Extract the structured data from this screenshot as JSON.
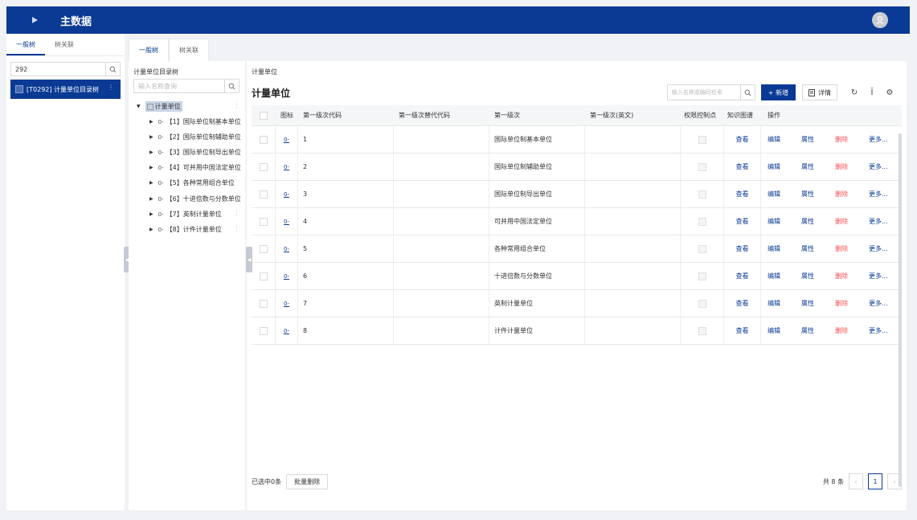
{
  "app": {
    "title": "主数据"
  },
  "left_panel": {
    "tabs": [
      "一般树",
      "树关联"
    ],
    "search_value": "292",
    "selected_item": "[T0292] 计量单位目录树"
  },
  "main_tabs": [
    "一般树",
    "树关联"
  ],
  "tree": {
    "label": "计量单位目录树",
    "search_placeholder": "输入名称查询",
    "root": "计量单位",
    "nodes": [
      "【1】国际单位制基本单位",
      "【2】国际单位制辅助单位",
      "【3】国际单位制导出单位",
      "【4】可并用中国法定单位",
      "【5】各种常用组合单位",
      "【6】十进倍数与分数单位",
      "【7】英制计量单位",
      "【8】计件计量单位"
    ]
  },
  "content": {
    "breadcrumb": "计量单位",
    "title": "计量单位",
    "search_placeholder": "输入名称或编码检索",
    "add_label": "+ 新增",
    "detail_label": "详情"
  },
  "grid": {
    "headers": [
      "图标",
      "第一级次代码",
      "第一级次替代代码",
      "第一级次",
      "第一级次(英文)",
      "权限控制点",
      "知识图谱",
      "操作"
    ],
    "rows": [
      {
        "code": "1",
        "alt": "",
        "name": "国际单位制基本单位",
        "en": ""
      },
      {
        "code": "2",
        "alt": "",
        "name": "国际单位制辅助单位",
        "en": ""
      },
      {
        "code": "3",
        "alt": "",
        "name": "国际单位制导出单位",
        "en": ""
      },
      {
        "code": "4",
        "alt": "",
        "name": "可并用中国法定单位",
        "en": ""
      },
      {
        "code": "5",
        "alt": "",
        "name": "各种常用组合单位",
        "en": ""
      },
      {
        "code": "6",
        "alt": "",
        "name": "十进倍数与分数单位",
        "en": ""
      },
      {
        "code": "7",
        "alt": "",
        "name": "英制计量单位",
        "en": ""
      },
      {
        "code": "8",
        "alt": "",
        "name": "计件计量单位",
        "en": ""
      }
    ],
    "actions": {
      "view": "查看",
      "edit": "编辑",
      "attr": "属性",
      "delete": "删除",
      "more": "更多..."
    }
  },
  "footer": {
    "selected": "已选中0条",
    "batch_delete": "批量删除",
    "total": "共 8 条",
    "page": "1"
  },
  "colors": {
    "brand": "#0a3a94",
    "danger": "#ff4d4f"
  }
}
